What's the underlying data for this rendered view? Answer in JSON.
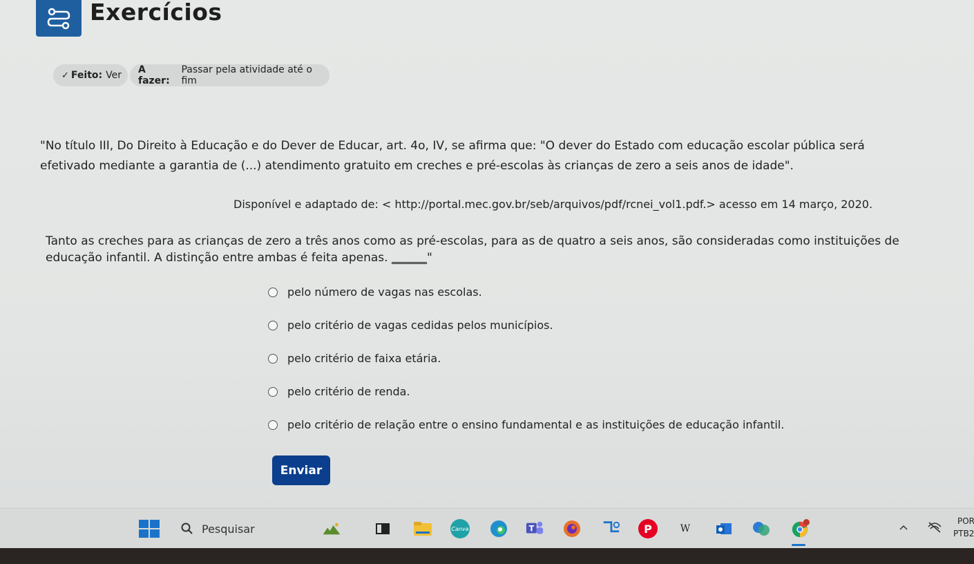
{
  "header": {
    "title": "Exercícios",
    "icon": "route-icon",
    "icon_color": "#1f5fa0"
  },
  "status": {
    "done_label": "Feito:",
    "done_value": "Ver",
    "todo_label": "A fazer:",
    "todo_value": "Passar pela atividade até o fim"
  },
  "question": {
    "line1": "\"No título III, Do Direito à Educação e do Dever de Educar, art. 4o, IV, se afirma que: \"O dever do Estado com educação escolar pública será",
    "line2": "efetivado mediante a garantia de (...) atendimento gratuito em creches e pré-escolas às crianças de zero a seis anos de idade\".",
    "source": "Disponível e adaptado de: < http://portal.mec.gov.br/seb/arquivos/pdf/rcnei_vol1.pdf.> acesso em 14 março, 2020.",
    "line3": "Tanto as creches para as crianças de zero a três anos como as pré-escolas, para as de quatro a seis anos, são consideradas como instituições de",
    "line4": "educação infantil. A distinção entre ambas é feita apenas.",
    "blank": "______",
    "close_quote": "\""
  },
  "options": [
    "pelo número de vagas nas escolas.",
    "pelo critério de vagas cedidas pelos municípios.",
    "pelo critério de faixa etária.",
    "pelo critério de renda.",
    "pelo critério de relação entre o ensino fundamental e as instituições de educação infantil."
  ],
  "submit_label": "Enviar",
  "taskbar": {
    "search_label": "Pesquisar",
    "tray_line1": "POR",
    "tray_line2": "PTB2",
    "accent": "#0b3e8c"
  }
}
